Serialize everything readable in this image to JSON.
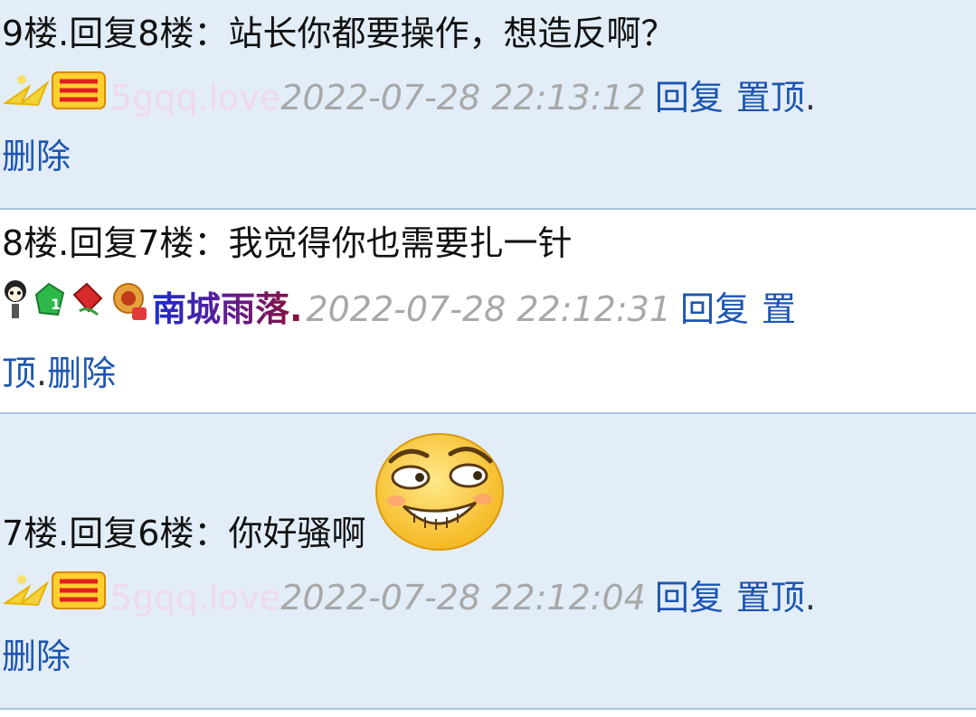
{
  "posts": [
    {
      "floor": "9楼.回复8楼：",
      "content": "站长你都要操作，想造反啊？",
      "user": "5gqq.love",
      "time": "2022-07-28 22:13:12",
      "actions": {
        "reply": "回复",
        "pin_a": "置顶",
        "pin_b": "",
        "dot": ".",
        "delete": "删除"
      }
    },
    {
      "floor": "8楼.回复7楼：",
      "content": "我觉得你也需要扎一针",
      "user": "南城雨落.",
      "time": "2022-07-28 22:12:31",
      "actions": {
        "reply": "回复",
        "pin_a": "置",
        "pin_b": "顶",
        "dot": ".",
        "delete": "删除"
      }
    },
    {
      "floor": "7楼.回复6楼：",
      "content": "你好骚啊",
      "user": "5gqq.love",
      "time": "2022-07-28 22:12:04",
      "actions": {
        "reply": "回复",
        "pin_a": "置顶",
        "pin_b": "",
        "dot": ".",
        "delete": "删除"
      }
    }
  ],
  "icons": [
    "money-badge-icon",
    "cartoon-avatar-icon",
    "green-gem-icon",
    "red-envelope-icon",
    "gift-badge-icon",
    "smirk-emoji-icon"
  ]
}
